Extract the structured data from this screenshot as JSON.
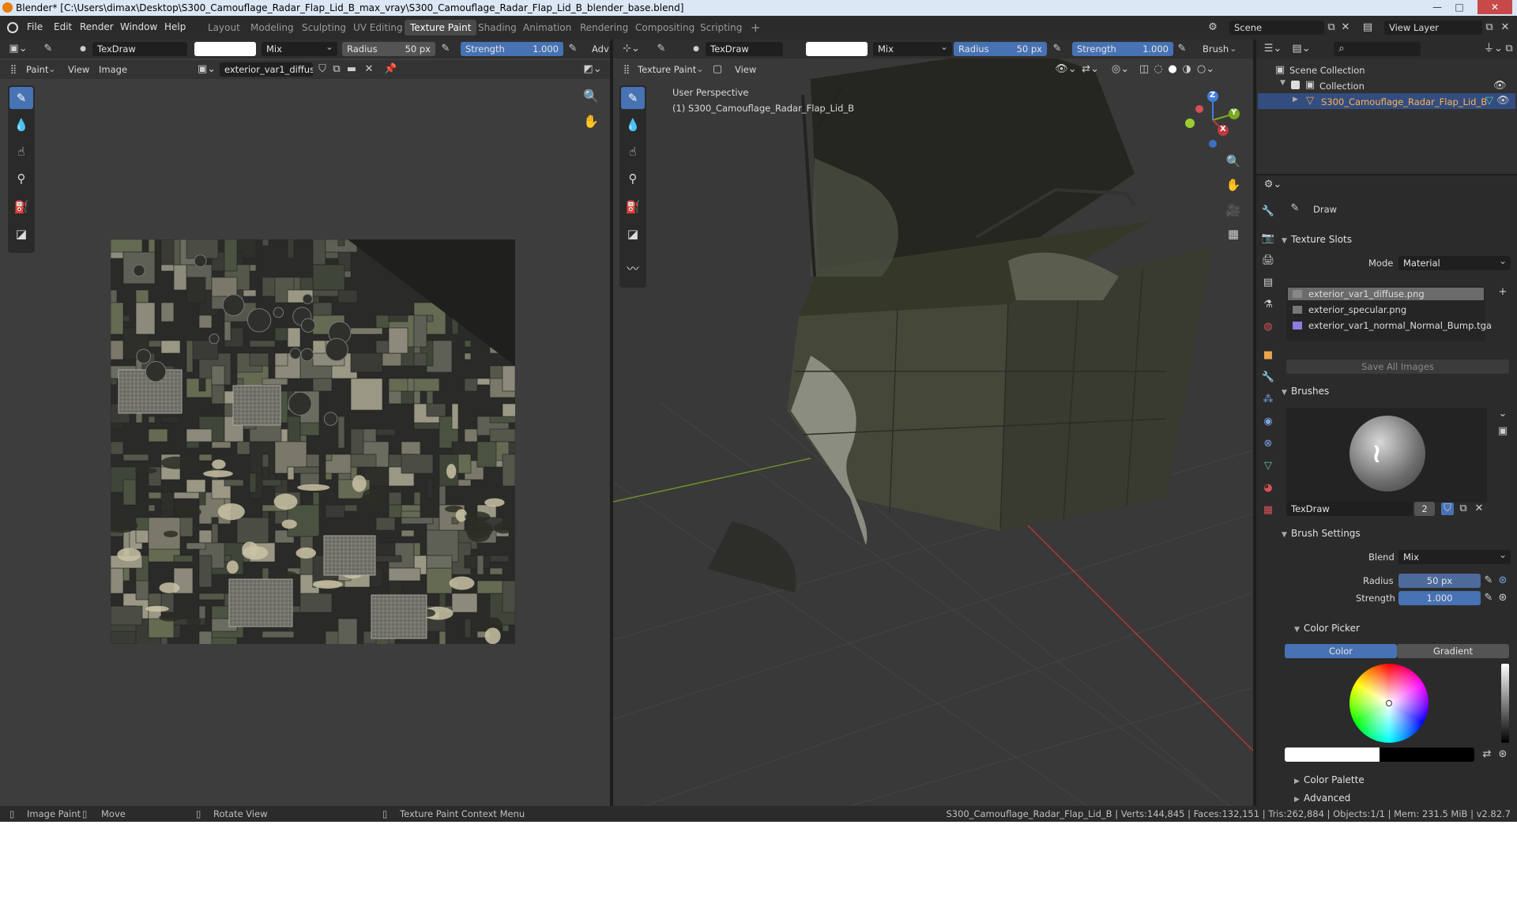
{
  "window": {
    "title": "Blender* [C:\\Users\\dimax\\Desktop\\S300_Camouflage_Radar_Flap_Lid_B_max_vray\\S300_Camouflage_Radar_Flap_Lid_B_blender_base.blend]",
    "minimize": "—",
    "maximize": "□",
    "close": "✕"
  },
  "menubar": {
    "menus": [
      "File",
      "Edit",
      "Render",
      "Window",
      "Help"
    ],
    "workspaces": [
      "Layout",
      "Modeling",
      "Sculpting",
      "UV Editing",
      "Texture Paint",
      "Shading",
      "Animation",
      "Rendering",
      "Compositing",
      "Scripting"
    ],
    "active_workspace": "Texture Paint",
    "add_workspace": "+",
    "scene": "Scene",
    "view_layer": "View Layer"
  },
  "image_editor": {
    "brush_name": "TexDraw",
    "blend": "Mix",
    "radius_label": "Radius",
    "radius_value": "50 px",
    "strength_label": "Strength",
    "strength_value": "1.000",
    "adv": "Adv",
    "mode": "Paint",
    "menu_view": "View",
    "menu_image": "Image",
    "image_name": "exterior_var1_diffus..",
    "tools": [
      "draw-brush",
      "soften",
      "smear",
      "clone",
      "fill",
      "mask"
    ]
  },
  "viewport": {
    "brush_name": "TexDraw",
    "blend": "Mix",
    "radius_label": "Radius",
    "radius_value": "50 px",
    "strength_label": "Strength",
    "strength_value": "1.000",
    "brush_menu": "Brush",
    "mode": "Texture Paint",
    "menu_view": "View",
    "perspective": "User Perspective",
    "object_label": "(1) S300_Camouflage_Radar_Flap_Lid_B",
    "axes": {
      "z": "Z",
      "y": "Y",
      "x": "X"
    },
    "colors": {
      "x_axis": "#c0373d",
      "y_axis": "#7ba91f",
      "z_axis": "#3f7fe0"
    }
  },
  "outliner": {
    "root": "Scene Collection",
    "collection": "Collection",
    "object": "S300_Camouflage_Radar_Flap_Lid_B"
  },
  "properties": {
    "tool_name": "Draw",
    "texture_slots": {
      "title": "Texture Slots",
      "mode_label": "Mode",
      "mode_value": "Material",
      "slots": [
        "exterior_var1_diffuse.png",
        "exterior_specular.png",
        "exterior_var1_normal_Normal_Bump.tga"
      ],
      "save_all": "Save All Images"
    },
    "brushes": {
      "title": "Brushes",
      "brush_name": "TexDraw",
      "users": "2"
    },
    "brush_settings": {
      "title": "Brush Settings",
      "blend_label": "Blend",
      "blend_value": "Mix",
      "radius_label": "Radius",
      "radius_value": "50 px",
      "strength_label": "Strength",
      "strength_value": "1.000"
    },
    "color_picker": {
      "title": "Color Picker",
      "tab_color": "Color",
      "tab_gradient": "Gradient",
      "primary": "#ffffff",
      "secondary": "#000000"
    },
    "color_palette": "Color Palette",
    "advanced": "Advanced"
  },
  "statusbar": {
    "image_paint": "Image Paint",
    "move": "Move",
    "rotate_view": "Rotate View",
    "context_menu": "Texture Paint Context Menu",
    "stats": "S300_Camouflage_Radar_Flap_Lid_B | Verts:144,845 | Faces:132,151 | Tris:262,884 | Objects:1/1 | Mem: 231.5 MiB | v2.82.7"
  },
  "theme": {
    "accent": "#4772b3",
    "bg": "#3d3d3d"
  }
}
